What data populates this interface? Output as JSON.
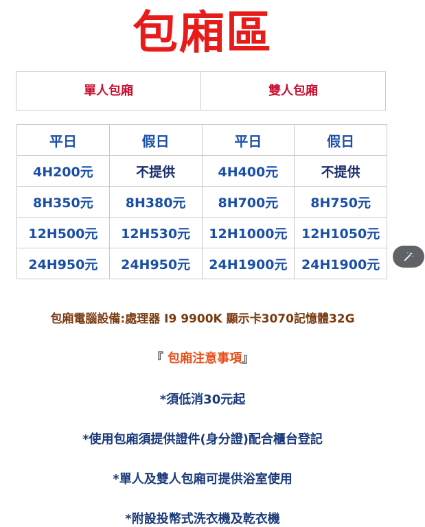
{
  "title": "包廂區",
  "room_types": {
    "single": "單人包廂",
    "double": "雙人包廂"
  },
  "price_table": {
    "headers": [
      "平日",
      "假日",
      "平日",
      "假日"
    ],
    "rows": [
      [
        "4H200元",
        "不提供",
        "4H400元",
        "不提供"
      ],
      [
        "8H350元",
        "8H380元",
        "8H700元",
        "8H750元"
      ],
      [
        "12H500元",
        "12H530元",
        "12H1000元",
        "12H1050元"
      ],
      [
        "24H950元",
        "24H950元",
        "24H1900元",
        "24H1900元"
      ]
    ]
  },
  "equipment": "包廂電腦設備:處理器 I9 9900K 顯示卡3070記憶體32G",
  "notice": {
    "open_bracket": "『",
    "text": " 包廂注意事項",
    "close_bracket": "』"
  },
  "rules": [
    "*須低消30元起",
    "*使用包廂須提供證件(身分證)配合櫃台登記",
    "*單人及雙人包廂可提供浴室使用",
    "*附設投幣式洗衣機及乾衣機"
  ],
  "icons": {
    "edit_fab": "magic-wand-icon"
  },
  "colors": {
    "title": "#e81b1b",
    "room_type": "#c8102e",
    "price": "#1a4fa8",
    "equipment": "#7a3a10",
    "notice": "#e8501a",
    "rules": "#1a3a7a",
    "fab": "#5f6368"
  }
}
